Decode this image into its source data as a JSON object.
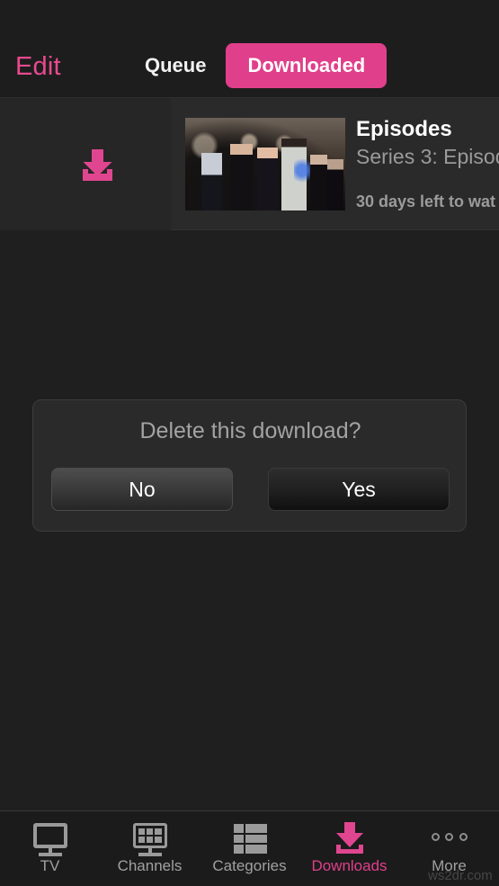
{
  "header": {
    "edit_label": "Edit",
    "segments": [
      {
        "label": "Queue",
        "active": false
      },
      {
        "label": "Downloaded",
        "active": true
      }
    ]
  },
  "list": {
    "row": {
      "delete_icon": "download-icon",
      "title": "Episodes",
      "subtitle": "Series 3: Episod",
      "meta": "30 days left to wat"
    }
  },
  "dialog": {
    "title": "Delete this download?",
    "no_label": "No",
    "yes_label": "Yes"
  },
  "tabbar": {
    "items": [
      {
        "label": "TV",
        "icon": "tv-icon",
        "active": false
      },
      {
        "label": "Channels",
        "icon": "channels-icon",
        "active": false
      },
      {
        "label": "Categories",
        "icon": "categories-icon",
        "active": false
      },
      {
        "label": "Downloads",
        "icon": "download-icon",
        "active": true
      },
      {
        "label": "More",
        "icon": "ellipsis-icon",
        "active": false
      }
    ]
  },
  "watermark": {
    "text": "ws2dr.com"
  },
  "colors": {
    "accent": "#e03f8b",
    "edit_pink": "#e84a8e",
    "background": "#1f1f1f",
    "panel": "#2a2a2a",
    "muted_text": "#9b9b9b"
  }
}
